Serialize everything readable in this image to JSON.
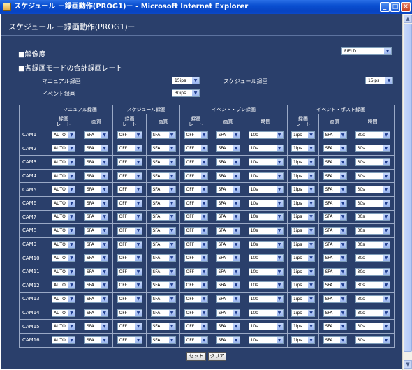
{
  "window": {
    "title": "スケジュール  －録画動作(PROG1)－ - Microsoft Internet Explorer"
  },
  "page": {
    "heading": "スケジュール  －録画動作(PROG1)－",
    "resolution": {
      "label": "■解像度",
      "value": "FIELD"
    },
    "total_rate": {
      "label": "■各録画モードの合計録画レート",
      "manual_label": "マニュアル録画",
      "manual_value": "15ips",
      "schedule_label": "スケジュール録画",
      "schedule_value": "15ips",
      "event_label": "イベント録画",
      "event_value": "30ips"
    }
  },
  "table": {
    "groups": [
      "マニュアル録画",
      "スケジュール録画",
      "イベント・プレ録画",
      "イベント・ポスト録画"
    ],
    "subheaders": [
      "録画\nレート",
      "画質",
      "録画\nレート",
      "画質",
      "録画\nレート",
      "画質",
      "時間",
      "録画\nレート",
      "画質",
      "時間"
    ],
    "rows": [
      {
        "cam": "CAM1",
        "values": [
          "AUTO",
          "SFA",
          "OFF",
          "SFA",
          "OFF",
          "SFA",
          "10s",
          "1ips",
          "SFA",
          "30s"
        ]
      },
      {
        "cam": "CAM2",
        "values": [
          "AUTO",
          "SFA",
          "OFF",
          "SFA",
          "OFF",
          "SFA",
          "10s",
          "1ips",
          "SFA",
          "30s"
        ]
      },
      {
        "cam": "CAM3",
        "values": [
          "AUTO",
          "SFA",
          "OFF",
          "SFA",
          "OFF",
          "SFA",
          "10s",
          "1ips",
          "SFA",
          "30s"
        ]
      },
      {
        "cam": "CAM4",
        "values": [
          "AUTO",
          "SFA",
          "OFF",
          "SFA",
          "OFF",
          "SFA",
          "10s",
          "1ips",
          "SFA",
          "30s"
        ]
      },
      {
        "cam": "CAM5",
        "values": [
          "AUTO",
          "SFA",
          "OFF",
          "SFA",
          "OFF",
          "SFA",
          "10s",
          "1ips",
          "SFA",
          "30s"
        ]
      },
      {
        "cam": "CAM6",
        "values": [
          "AUTO",
          "SFA",
          "OFF",
          "SFA",
          "OFF",
          "SFA",
          "10s",
          "1ips",
          "SFA",
          "30s"
        ]
      },
      {
        "cam": "CAM7",
        "values": [
          "AUTO",
          "SFA",
          "OFF",
          "SFA",
          "OFF",
          "SFA",
          "10s",
          "1ips",
          "SFA",
          "30s"
        ]
      },
      {
        "cam": "CAM8",
        "values": [
          "AUTO",
          "SFA",
          "OFF",
          "SFA",
          "OFF",
          "SFA",
          "10s",
          "1ips",
          "SFA",
          "30s"
        ]
      },
      {
        "cam": "CAM9",
        "values": [
          "AUTO",
          "SFA",
          "OFF",
          "SFA",
          "OFF",
          "SFA",
          "10s",
          "1ips",
          "SFA",
          "30s"
        ]
      },
      {
        "cam": "CAM10",
        "values": [
          "AUTO",
          "SFA",
          "OFF",
          "SFA",
          "OFF",
          "SFA",
          "10s",
          "1ips",
          "SFA",
          "30s"
        ]
      },
      {
        "cam": "CAM11",
        "values": [
          "AUTO",
          "SFA",
          "OFF",
          "SFA",
          "OFF",
          "SFA",
          "10s",
          "1ips",
          "SFA",
          "30s"
        ]
      },
      {
        "cam": "CAM12",
        "values": [
          "AUTO",
          "SFA",
          "OFF",
          "SFA",
          "OFF",
          "SFA",
          "10s",
          "1ips",
          "SFA",
          "30s"
        ]
      },
      {
        "cam": "CAM13",
        "values": [
          "AUTO",
          "SFA",
          "OFF",
          "SFA",
          "OFF",
          "SFA",
          "10s",
          "1ips",
          "SFA",
          "30s"
        ]
      },
      {
        "cam": "CAM14",
        "values": [
          "AUTO",
          "SFA",
          "OFF",
          "SFA",
          "OFF",
          "SFA",
          "10s",
          "1ips",
          "SFA",
          "30s"
        ]
      },
      {
        "cam": "CAM15",
        "values": [
          "AUTO",
          "SFA",
          "OFF",
          "SFA",
          "OFF",
          "SFA",
          "10s",
          "1ips",
          "SFA",
          "30s"
        ]
      },
      {
        "cam": "CAM16",
        "values": [
          "AUTO",
          "SFA",
          "OFF",
          "SFA",
          "OFF",
          "SFA",
          "10s",
          "1ips",
          "SFA",
          "30s"
        ]
      }
    ]
  },
  "buttons": {
    "set": "セット",
    "clear": "クリア"
  },
  "icons": {
    "dropdown": "chevron-down-icon",
    "app": "ie-app-icon"
  },
  "colors": {
    "page_bg": "#2a3f6b",
    "titlebar": "#0a4fd0",
    "grid_line": "#9aa9c6"
  }
}
